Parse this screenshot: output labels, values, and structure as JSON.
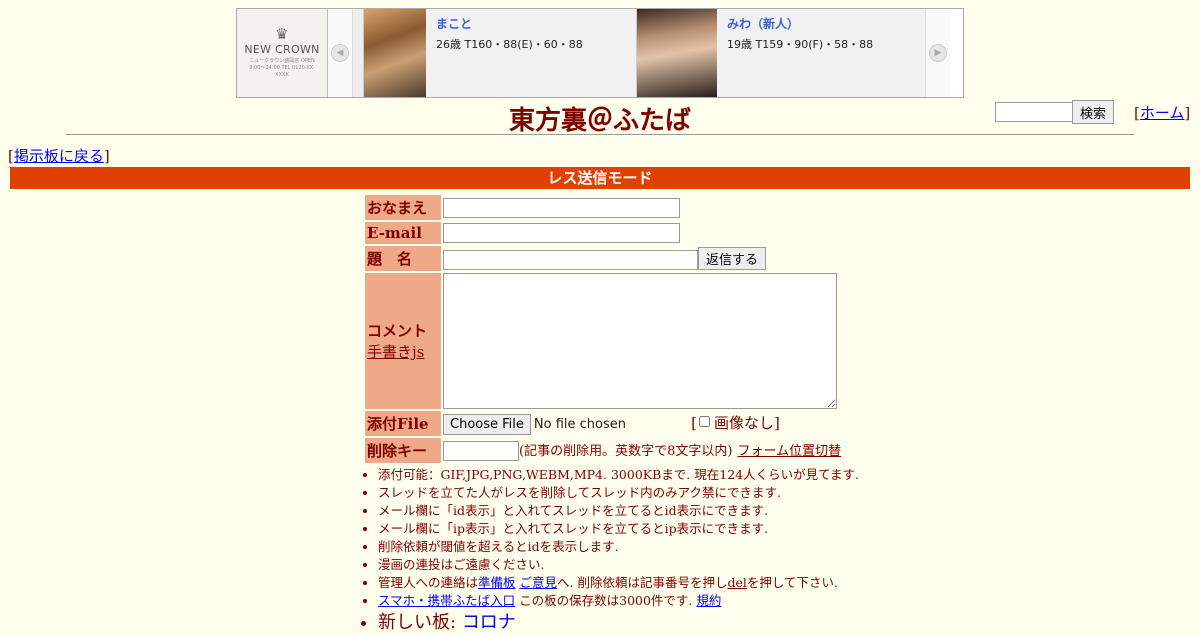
{
  "banner": {
    "logo": {
      "name": "NEW CROWN",
      "sub": "ニュークラウン盛岡店 OPEN 9:00〜24:00 TEL 0120-XX-XXXX"
    },
    "girls": [
      {
        "name": "まこと",
        "spec": "26歳 T160・88(E)・60・88"
      },
      {
        "name": "みわ（新人）",
        "spec": "19歳 T159・90(F)・58・88"
      }
    ]
  },
  "header": {
    "title": "東方裏＠ふたば",
    "search_button": "検索",
    "home_link": "ホーム",
    "back_link": "掲示板に戻る"
  },
  "mode_bar": "レス送信モード",
  "form": {
    "name_label": "おなまえ",
    "email_label": "E-mail",
    "subject_label": "題　名",
    "submit_button": "返信する",
    "comment_label": "コメント",
    "handwrite_link": "手書きjs",
    "file_label": "添付File",
    "file_button": "Choose File",
    "file_status": "No file chosen",
    "noimg_label": "画像なし",
    "delkey_label": "削除キー",
    "delkey_note": "(記事の削除用。英数字で8文字以内)",
    "form_position_link": "フォーム位置切替"
  },
  "notes": {
    "n1": "添付可能：GIF,JPG,PNG,WEBM,MP4. 3000KBまで. 現在124人くらいが見てます.",
    "n2": "スレッドを立てた人がレスを削除してスレッド内のみアク禁にできます.",
    "n3": "メール欄に「id表示」と入れてスレッドを立てるとid表示にできます.",
    "n4": "メール欄に「ip表示」と入れてスレッドを立てるとip表示にできます.",
    "n5": "削除依頼が閾値を超えるとidを表示します.",
    "n6": "漫画の連投はご遠慮ください.",
    "n7_a": "管理人への連絡は",
    "n7_link1": "準備板",
    "n7_link2": "ご意見",
    "n7_b": "へ. 削除依頼は記事番号を押し",
    "n7_del": "del",
    "n7_c": "を押して下さい.",
    "n8_link": "スマホ・携帯ふたば入口",
    "n8_text": "この板の保存数は3000件です.",
    "n8_rules": "規約",
    "n9_label": "新しい板:",
    "n9_link": "コロナ"
  },
  "colors": {
    "accent": "#e04000",
    "label_bg": "#eeaa88",
    "text": "#800000",
    "bg": "#ffffee"
  }
}
